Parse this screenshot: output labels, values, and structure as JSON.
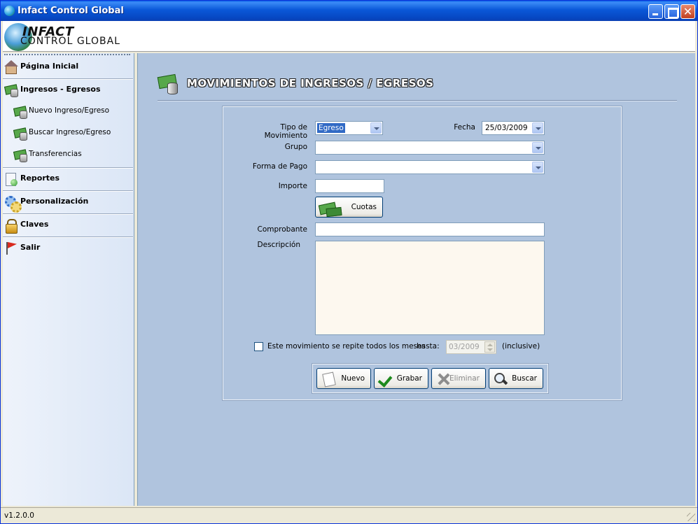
{
  "window": {
    "title": "Infact Control Global"
  },
  "banner": {
    "logo_line1": "INFACT",
    "logo_line2": "CONTROL GLOBAL"
  },
  "sidebar": {
    "sections": [
      {
        "label": "Página Inicial",
        "icon": "house-icon"
      },
      {
        "label": "Ingresos - Egresos",
        "icon": "money-icon"
      },
      {
        "label": "Reportes",
        "icon": "report-icon"
      },
      {
        "label": "Personalización",
        "icon": "gear-icon"
      },
      {
        "label": "Claves",
        "icon": "lock-icon"
      },
      {
        "label": "Salir",
        "icon": "flag-icon"
      }
    ],
    "subitems": [
      {
        "label": "Nuevo Ingreso/Egreso",
        "icon": "money-icon"
      },
      {
        "label": "Buscar Ingreso/Egreso",
        "icon": "money-icon"
      },
      {
        "label": "Transferencias",
        "icon": "money-icon"
      }
    ]
  },
  "page": {
    "title": "MOVIMIENTOS DE INGRESOS / EGRESOS"
  },
  "form": {
    "tipo_label": "Tipo de Movimiento",
    "tipo_value": "Egreso",
    "fecha_label": "Fecha",
    "fecha_value": "25/03/2009",
    "grupo_label": "Grupo",
    "grupo_value": "",
    "forma_pago_label": "Forma de Pago",
    "forma_pago_value": "",
    "importe_label": "Importe",
    "importe_value": "",
    "cuotas_label": "Cuotas",
    "comprobante_label": "Comprobante",
    "comprobante_value": "",
    "descripcion_label": "Descripción",
    "descripcion_value": "",
    "repeat_label": "Este movimiento se repite todos los meses",
    "repeat_checked": false,
    "hasta_label": "hasta:",
    "hasta_value": "03/2009",
    "inclusive_label": "(inclusive)"
  },
  "actions": {
    "nuevo": "Nuevo",
    "grabar": "Grabar",
    "eliminar": "Eliminar",
    "buscar": "Buscar"
  },
  "statusbar": {
    "version": "v1.2.0.0"
  },
  "colors": {
    "titlebar": "#0a58d8",
    "main_bg": "#b0c4de",
    "sidebar_bg": "#dbe6f6",
    "selection": "#316ac5"
  }
}
